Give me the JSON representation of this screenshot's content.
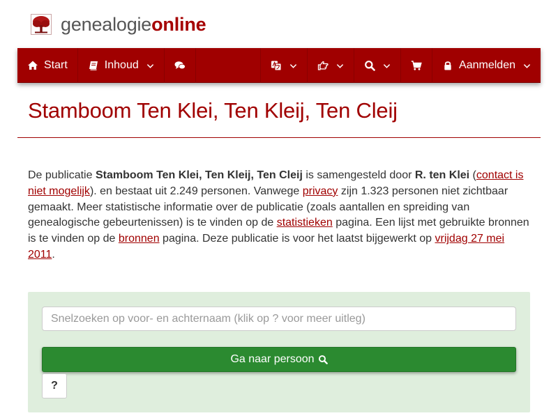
{
  "brand": {
    "name_light": "genealogie",
    "name_strong": "online",
    "logo_icon": "tree-icon",
    "accent_color": "#a00000"
  },
  "navbar": {
    "start_label": "Start",
    "inhoud_label": "Inhoud",
    "login_label": "Aanmelden",
    "icons": [
      "home-icon",
      "book-icon",
      "comments-icon",
      "language-icon",
      "hand-point-icon",
      "search-icon",
      "cart-icon",
      "lock-icon"
    ]
  },
  "page": {
    "title": "Stamboom Ten Klei, Ten Kleij, Ten Cleij"
  },
  "intro": {
    "t1": "De publicatie ",
    "pub_name": "Stamboom Ten Klei, Ten Kleij, Ten Cleij",
    "t2": " is samengesteld door ",
    "author": "R. ten Klei",
    "t3": " (",
    "contact_link": "contact is niet mogelijk",
    "t4": "). en bestaat uit 2.249 personen. Vanwege ",
    "privacy_link": "privacy",
    "t5": " zijn 1.323 personen niet zichtbaar gemaakt. Meer statistische informatie over de publicatie (zoals aantallen en spreiding van genealogische gebeurtenissen) is te vinden op de ",
    "stats_link": "statistieken",
    "t6": " pagina. Een lijst met gebruikte bronnen is te vinden op de ",
    "sources_link": "bronnen",
    "t7": " pagina. Deze publicatie is voor het laatst bijgewerkt op ",
    "date_link": "vrijdag 27 mei 2011",
    "t8": "."
  },
  "search": {
    "placeholder": "Snelzoeken op voor- en achternaam (klik op ? voor meer uitleg)",
    "value": "",
    "go_label": "Ga naar persoon",
    "help_label": "?",
    "panel_color": "#dfeedd",
    "button_color": "#2b8a30"
  }
}
